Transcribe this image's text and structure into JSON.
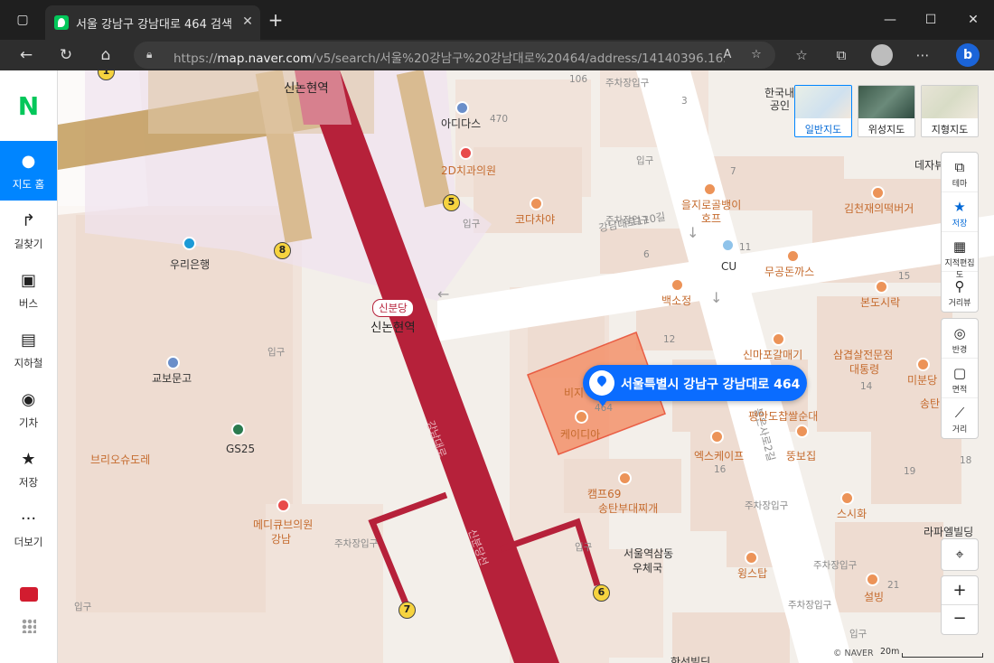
{
  "browser": {
    "tab_title": "서울 강남구 강남대로 464 검색 -",
    "url_prefix": "https://",
    "url_host": "map.naver.com",
    "url_path": "/v5/search/서울%20강남구%20강남대로%20464/address/14140396.16..."
  },
  "leftnav": {
    "logo": "N",
    "items": [
      {
        "label": "지도 홈",
        "icon": "map-pin-icon",
        "active": true
      },
      {
        "label": "길찾기",
        "icon": "directions-icon"
      },
      {
        "label": "버스",
        "icon": "bus-icon"
      },
      {
        "label": "지하철",
        "icon": "subway-icon"
      },
      {
        "label": "기차",
        "icon": "train-icon"
      },
      {
        "label": "저장",
        "icon": "star-icon"
      },
      {
        "label": "더보기",
        "icon": "more-icon"
      }
    ]
  },
  "map": {
    "map_types": [
      {
        "label": "일반지도",
        "selected": true
      },
      {
        "label": "위성지도"
      },
      {
        "label": "지형지도"
      }
    ],
    "tools": [
      {
        "label": "테마",
        "icon": "theme-icon"
      },
      {
        "label": "저장",
        "icon": "star-icon",
        "active": true
      },
      {
        "label": "지적편집도",
        "icon": "cadastral-icon"
      },
      {
        "label": "거리뷰",
        "icon": "street-view-icon"
      }
    ],
    "tools2": [
      {
        "label": "반경",
        "icon": "radius-icon"
      },
      {
        "label": "면적",
        "icon": "area-icon"
      },
      {
        "label": "거리",
        "icon": "ruler-icon"
      }
    ],
    "marker_address": "서울특별시 강남구 강남대로 464",
    "station_badge": "신분당",
    "station_name": "신논현역",
    "copyright": "© NAVER",
    "scale": "20m",
    "labels": {
      "sinnonhyeon_top": "신논현역",
      "adidas": "아디다스",
      "n470": "470",
      "dental": "2D치과의원",
      "kodachaya": "코다차야",
      "entrance1": "입구",
      "entrance2": "입구",
      "entrance3": "입구",
      "entrance4": "입구",
      "entrance5": "입구",
      "entrance6": "입구",
      "parking1": "주차장입구",
      "parking2": "주차장입구",
      "parking3": "주차장입구",
      "parking4": "주차장입구",
      "parking5": "주차장입구",
      "parking6": "주차장입구",
      "woori": "우리은행",
      "kyobo": "교보문고",
      "gs25": "GS25",
      "brio": "브리오슈도레",
      "medicube": "메디큐브의원",
      "gangnam_branch": "강남",
      "road_110": "강남대로110길",
      "eulji": "을지로골뱅이",
      "hof": "호프",
      "cu": "CU",
      "bakso": "백소정",
      "mugong": "무공돈까스",
      "bondo": "본도시락",
      "kimcheonjae": "김천재의떡버거",
      "desert": "데자뷰",
      "sinmapo": "신마포갈매기",
      "samgyeop": "삼겹살전문점",
      "daetong": "대통령",
      "mibong": "미분당",
      "song": "송탄",
      "pyeongando": "평안도찹쌀순대",
      "ttongbo": "뚱보집",
      "xscape": "엑스케이프",
      "keidia": "케이디아",
      "bija": "비지",
      "camp69": "캠프69",
      "songtan_budae": "송탄부대찌개",
      "sushi": "스시화",
      "samdong_post1": "서울역삼동",
      "samdong_post2": "우체국",
      "wingstop": "윙스탑",
      "seolbing": "설빙",
      "lafael": "라파엘빌딩",
      "hanseon": "한선빌딩",
      "korean_notary": "한국내",
      "gongin": "공인",
      "road_2": "봉은사로2길",
      "gangnamdaero": "강남대로",
      "sinbundang_line": "신분당선",
      "n106": "106",
      "n3": "3",
      "n7": "7",
      "n6": "6",
      "n11": "11",
      "n12": "12",
      "n14": "14",
      "n15": "15",
      "n16": "16",
      "n18": "18",
      "n19": "19",
      "n21": "21",
      "n464": "464",
      "n1": "1",
      "n5": "5"
    },
    "exits": [
      "5",
      "8",
      "7",
      "6",
      "1"
    ]
  }
}
